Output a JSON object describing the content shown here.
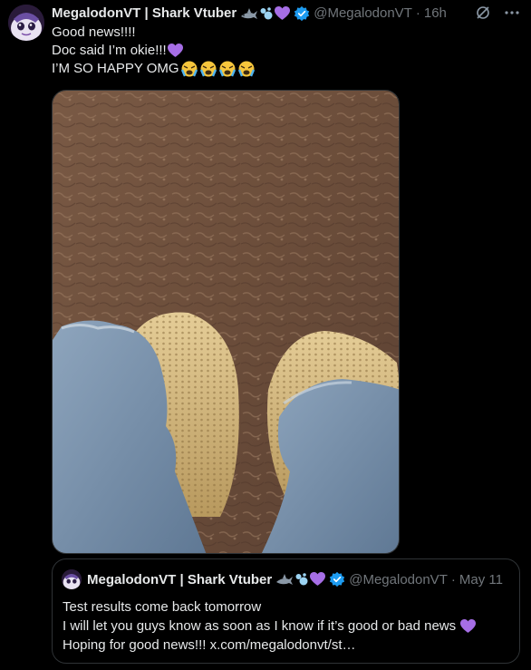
{
  "tweet": {
    "display_name": "MegalodonVT | Shark Vtuber",
    "handle": "@MegalodonVT",
    "separator": "·",
    "time": "16h",
    "name_emoji": [
      "shark",
      "bubbles",
      "purple-heart"
    ],
    "lines": [
      "Good news!!!!",
      "Doc said I’m okie!!!",
      "I’M SO HAPPY OMG"
    ]
  },
  "quote": {
    "display_name": "MegalodonVT | Shark Vtuber",
    "handle": "@MegalodonVT",
    "separator": "·",
    "time": "May 11",
    "lines": [
      "Test results come back tomorrow",
      "I will let you guys know as soon as I know if it’s good or bad news",
      "Hoping for good news!!! x.com/megalodonvt/st…"
    ]
  },
  "colors": {
    "background": "#000000",
    "text": "#e7e9ea",
    "muted": "#71767b",
    "verified": "#1d9bf0",
    "border": "#2f3336",
    "purple_heart": "#a66ee6"
  }
}
